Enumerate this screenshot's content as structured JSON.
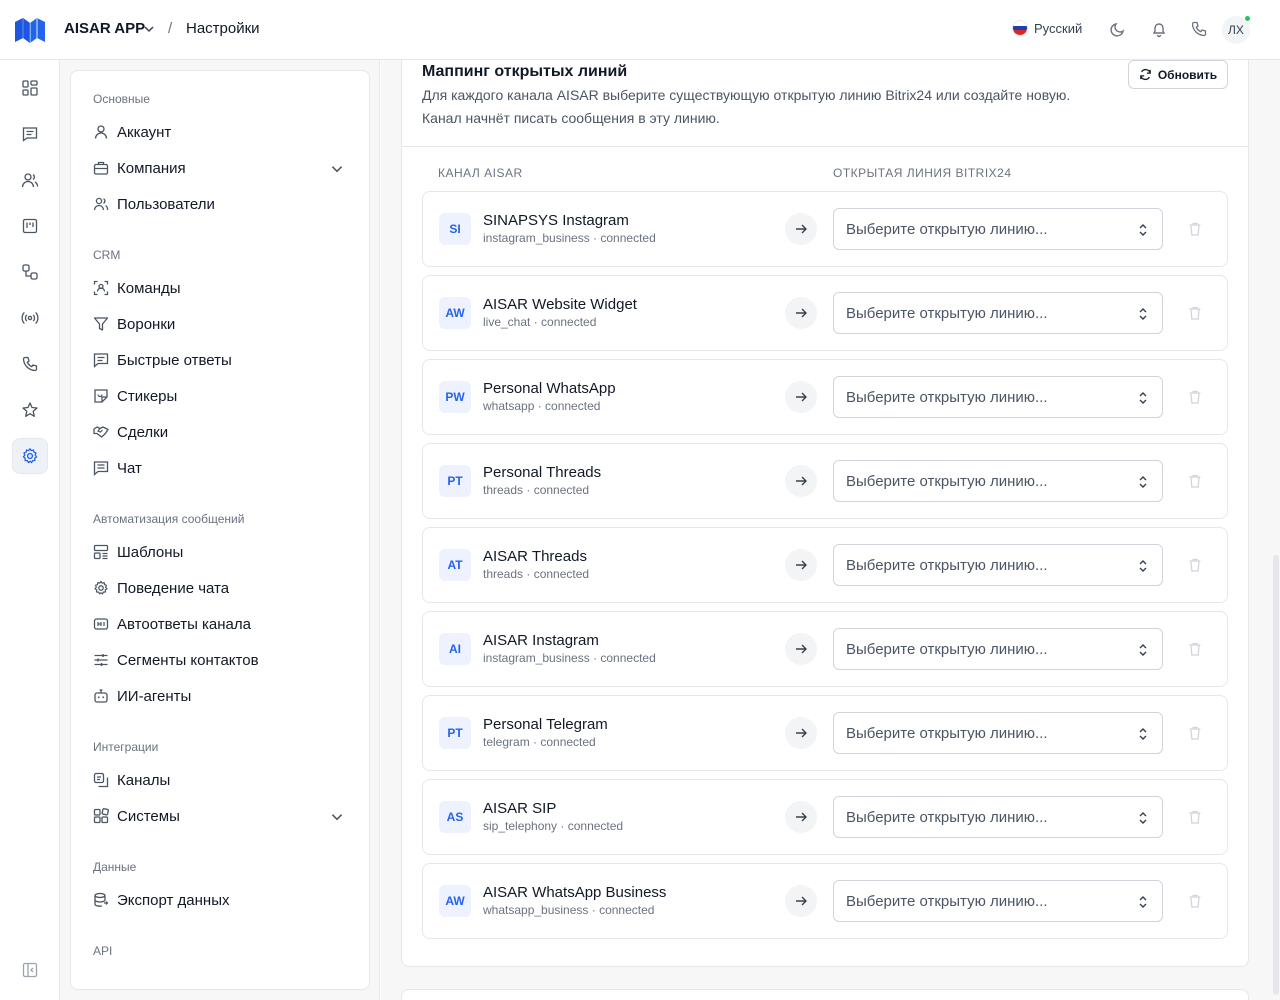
{
  "header": {
    "app_name": "AISAR APP",
    "separator": "/",
    "page": "Настройки",
    "language": "Русский",
    "avatar_initials": "ЛХ",
    "online_color": "#22c55e"
  },
  "rail": {
    "items": [
      {
        "icon": "dashboard-icon",
        "active": false
      },
      {
        "icon": "messages-icon",
        "active": false
      },
      {
        "icon": "contacts-icon",
        "active": false
      },
      {
        "icon": "kanban-icon",
        "active": false
      },
      {
        "icon": "workflow-icon",
        "active": false
      },
      {
        "icon": "broadcast-icon",
        "active": false
      },
      {
        "icon": "phone-icon",
        "active": false
      },
      {
        "icon": "star-icon",
        "active": false
      },
      {
        "icon": "settings-icon",
        "active": true
      }
    ],
    "accent": "#2563eb"
  },
  "sidebar": {
    "sections": [
      {
        "title": "Основные",
        "items": [
          {
            "label": "Аккаунт",
            "icon": "user-icon"
          },
          {
            "label": "Компания",
            "icon": "briefcase-icon",
            "expandable": true
          },
          {
            "label": "Пользователи",
            "icon": "users-icon"
          }
        ]
      },
      {
        "title": "CRM",
        "items": [
          {
            "label": "Команды",
            "icon": "team-scan-icon"
          },
          {
            "label": "Воронки",
            "icon": "funnel-icon"
          },
          {
            "label": "Быстрые ответы",
            "icon": "quick-reply-icon"
          },
          {
            "label": "Стикеры",
            "icon": "sticker-icon"
          },
          {
            "label": "Сделки",
            "icon": "handshake-icon"
          },
          {
            "label": "Чат",
            "icon": "chat-icon"
          }
        ]
      },
      {
        "title": "Автоматизация сообщений",
        "items": [
          {
            "label": "Шаблоны",
            "icon": "template-icon"
          },
          {
            "label": "Поведение чата",
            "icon": "gear-icon"
          },
          {
            "label": "Автоответы канала",
            "icon": "autoreply-icon"
          },
          {
            "label": "Сегменты контактов",
            "icon": "sliders-icon"
          },
          {
            "label": "ИИ-агенты",
            "icon": "bot-icon"
          }
        ]
      },
      {
        "title": "Интеграции",
        "items": [
          {
            "label": "Каналы",
            "icon": "channels-icon"
          },
          {
            "label": "Системы",
            "icon": "systems-icon",
            "expandable": true
          }
        ]
      },
      {
        "title": "Данные",
        "items": [
          {
            "label": "Экспорт данных",
            "icon": "database-export-icon"
          }
        ]
      },
      {
        "title": "API",
        "items": []
      }
    ]
  },
  "main": {
    "title": "Маппинг открытых линий",
    "description": "Для каждого канала AISAR выберите существующую открытую линию Bitrix24 или создайте новую. Канал начнёт писать сообщения в эту линию.",
    "refresh_label": "Обновить",
    "col_channel": "КАНАЛ AISAR",
    "col_line": "ОТКРЫТАЯ ЛИНИЯ BITRIX24",
    "select_placeholder": "Выберите открытую линию...",
    "rows": [
      {
        "badge": "SI",
        "name": "SINAPSYS Instagram",
        "sub": "instagram_business · connected"
      },
      {
        "badge": "AW",
        "name": "AISAR Website Widget",
        "sub": "live_chat · connected"
      },
      {
        "badge": "PW",
        "name": "Personal WhatsApp",
        "sub": "whatsapp · connected"
      },
      {
        "badge": "PT",
        "name": "Personal Threads",
        "sub": "threads · connected"
      },
      {
        "badge": "AT",
        "name": "AISAR Threads",
        "sub": "threads · connected"
      },
      {
        "badge": "AI",
        "name": "AISAR Instagram",
        "sub": "instagram_business · connected"
      },
      {
        "badge": "PT",
        "name": "Personal Telegram",
        "sub": "telegram · connected"
      },
      {
        "badge": "AS",
        "name": "AISAR SIP",
        "sub": "sip_telephony · connected"
      },
      {
        "badge": "AW",
        "name": "AISAR WhatsApp Business",
        "sub": "whatsapp_business · connected"
      }
    ]
  }
}
